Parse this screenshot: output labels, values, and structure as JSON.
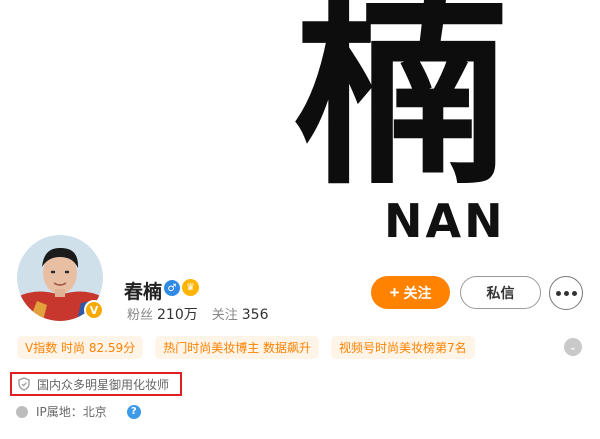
{
  "cover": {
    "calligraphy_char": "楠",
    "english": "NAN"
  },
  "profile": {
    "name": "春楠",
    "verified_badge": "V",
    "gender_icon": "♂",
    "crown_icon": "♛",
    "fans_label": "粉丝",
    "fans_value": "210万",
    "following_label": "关注",
    "following_value": "356"
  },
  "actions": {
    "follow_plus": "+",
    "follow_label": "关注",
    "message_label": "私信"
  },
  "tags": [
    "V指数 时尚 82.59分",
    "热门时尚美妆博主 数据飙升",
    "视频号时尚美妆榜第7名"
  ],
  "expand_icon": "⌄",
  "certification": "国内众多明星御用化妆师",
  "ip": {
    "text": "IP属地：北京",
    "help_icon": "?"
  },
  "colors": {
    "accent": "#ff8200",
    "tag_bg": "#fff4e8",
    "highlight_border": "#e02020",
    "verified": "#f7a900",
    "male": "#2f8ae5"
  }
}
